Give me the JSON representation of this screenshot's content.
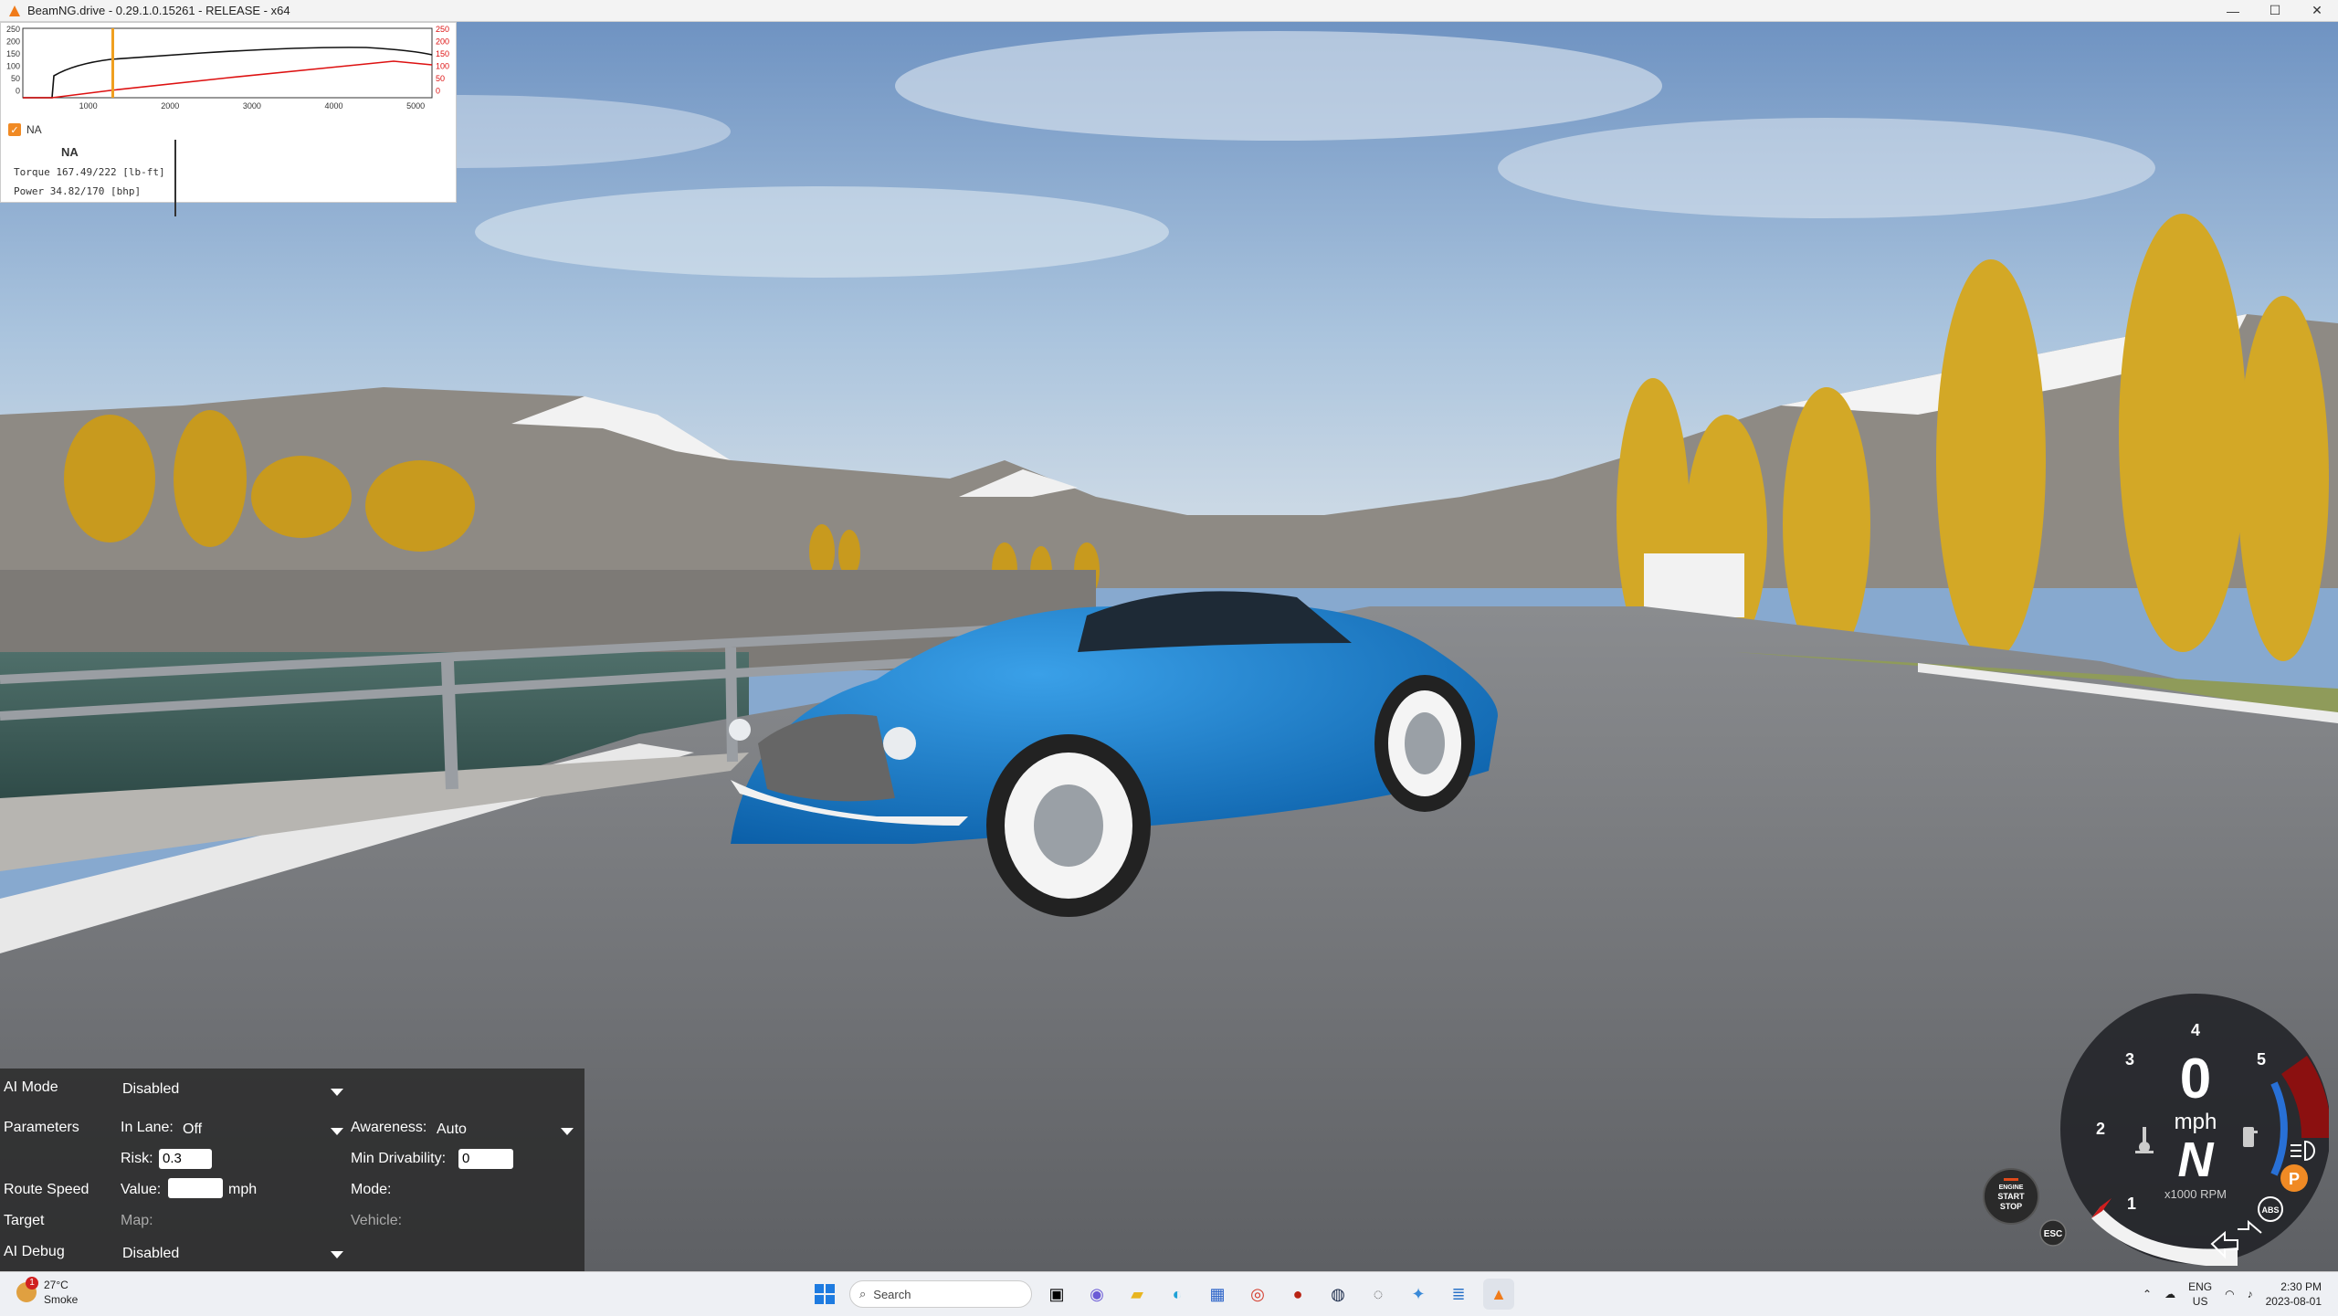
{
  "window": {
    "title": "BeamNG.drive - 0.29.1.0.15261 - RELEASE - x64",
    "min": "—",
    "max": "☐",
    "close": "✕"
  },
  "graph": {
    "y_left_ticks": [
      "250",
      "200",
      "150",
      "100",
      "50",
      "0"
    ],
    "y_right_ticks": [
      "250",
      "200",
      "150",
      "100",
      "50",
      "0"
    ],
    "x_ticks": [
      "1000",
      "2000",
      "3000",
      "4000",
      "5000"
    ],
    "legend_label": "NA",
    "readout_title": "NA",
    "torque_text": "Torque 167.49/222 [lb-ft]",
    "power_text": "Power  34.82/170  [bhp]",
    "colors": {
      "torque": "#111111",
      "power": "#dd1111",
      "marker": "#f0a020"
    }
  },
  "ai_panel": {
    "ai_mode_label": "AI Mode",
    "ai_mode_value": "Disabled",
    "parameters_label": "Parameters",
    "in_lane_label": "In Lane:",
    "in_lane_value": "Off",
    "awareness_label": "Awareness:",
    "awareness_value": "Auto",
    "risk_label": "Risk:",
    "risk_value": "0.3",
    "min_drivability_label": "Min Drivability:",
    "min_drivability_value": "0",
    "route_speed_label": "Route Speed",
    "value_label": "Value:",
    "value_value": "",
    "unit": "mph",
    "mode_label": "Mode:",
    "target_label": "Target",
    "map_label": "Map:",
    "vehicle_label": "Vehicle:",
    "ai_debug_label": "AI Debug",
    "ai_debug_value": "Disabled"
  },
  "dash": {
    "speed": "0",
    "unit": "mph",
    "gear": "N",
    "rpm_label": "x1000 RPM",
    "rpm_ticks": [
      "1",
      "2",
      "3",
      "4",
      "5"
    ],
    "engine_btn": [
      "ENGINE",
      "START",
      "STOP"
    ],
    "esc_label": "ESC",
    "abs_label": "ABS",
    "park_label": "P"
  },
  "taskbar": {
    "temp": "27°C",
    "weather": "Smoke",
    "badge": "1",
    "search_placeholder": "Search",
    "lang_top": "ENG",
    "lang_bottom": "US",
    "time": "2:30 PM",
    "date": "2023-08-01"
  }
}
